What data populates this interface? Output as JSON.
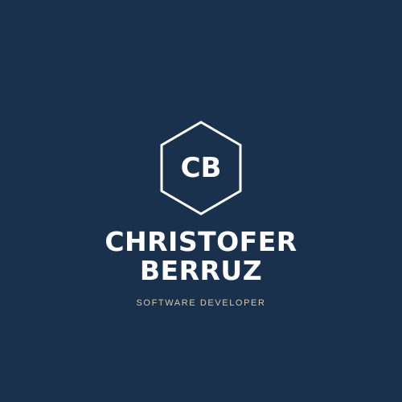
{
  "logo": {
    "monogram": "CB",
    "name_line_1": "CHRISTOFER",
    "name_line_2": "BERRUZ",
    "tagline": "SOFTWARE DEVELOPER",
    "shape": "hexagon-outline"
  },
  "colors": {
    "background": "#1a314d",
    "primary_text": "#ffffff",
    "accent_text": "#d9c9a3"
  }
}
